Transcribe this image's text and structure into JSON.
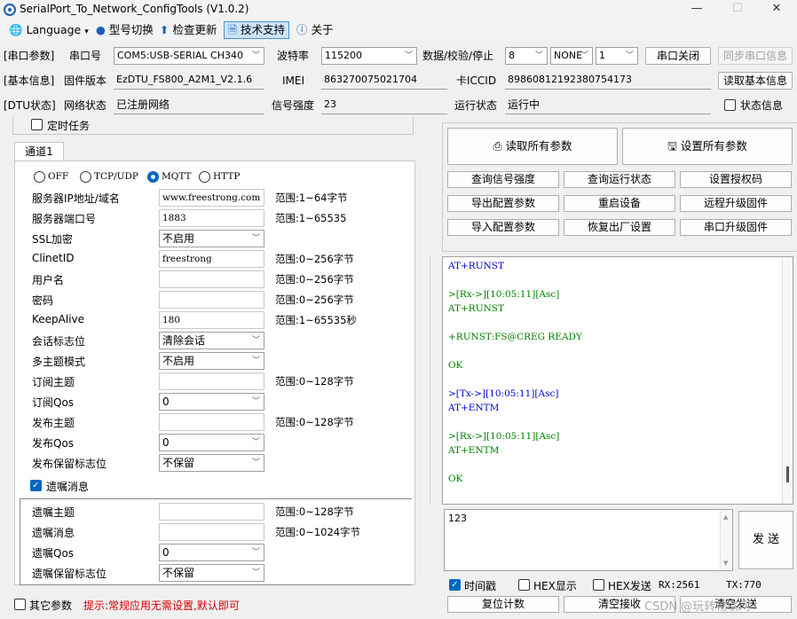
{
  "window": {
    "title": "SerialPort_To_Network_ConfigTools (V1.0.2)",
    "minimize": "—",
    "maximize": "☐",
    "close": "✕"
  },
  "menu": {
    "language": "Language",
    "model_switch": "型号切换",
    "check_update": "检查更新",
    "tech_support": "技术支持",
    "about": "关于"
  },
  "serial": {
    "section": "[串口参数]",
    "port_label": "串口号",
    "port_value": "COM5:USB-SERIAL CH340",
    "baud_label": "波特率",
    "baud_value": "115200",
    "dps_label": "数据/校验/停止",
    "data_bits": "8",
    "parity": "NONE",
    "stop_bits": "1",
    "close_button": "串口关闭",
    "sync_button": "同步串口信息"
  },
  "basic": {
    "section": "[基本信息]",
    "fw_label": "固件版本",
    "fw_value": "EzDTU_FS800_A2M1_V2.1.6",
    "imei_label": "IMEI",
    "imei_value": "863270075021704",
    "iccid_label": "卡ICCID",
    "iccid_value": "89860812192380754173",
    "read_button": "读取基本信息"
  },
  "status": {
    "section": "[DTU状态]",
    "net_label": "网络状态",
    "net_value": "已注册网络",
    "signal_label": "信号强度",
    "signal_value": "23",
    "run_label": "运行状态",
    "run_value": "运行中",
    "status_info": "状态信息"
  },
  "timer_task": "定时任务",
  "channel": {
    "tab": "通道1",
    "protocols": [
      "OFF",
      "TCP/UDP",
      "MQTT",
      "HTTP"
    ],
    "selected_protocol": "MQTT",
    "fields": [
      {
        "label": "服务器IP地址/域名",
        "value": "www.freestrong.com",
        "range": "范围:1~64字节",
        "type": "text"
      },
      {
        "label": "服务器端口号",
        "value": "1883",
        "range": "范围:1~65535",
        "type": "text"
      },
      {
        "label": "SSL加密",
        "value": "不启用",
        "range": "",
        "type": "select"
      },
      {
        "label": "ClinetID",
        "value": "freestrong",
        "range": "范围:0~256字节",
        "type": "text"
      },
      {
        "label": "用户名",
        "value": "",
        "range": "范围:0~256字节",
        "type": "text"
      },
      {
        "label": "密码",
        "value": "",
        "range": "范围:0~256字节",
        "type": "text"
      },
      {
        "label": "KeepAlive",
        "value": "180",
        "range": "范围:1~65535秒",
        "type": "text"
      },
      {
        "label": "会话标志位",
        "value": "清除会话",
        "range": "",
        "type": "select"
      },
      {
        "label": "多主题模式",
        "value": "不启用",
        "range": "",
        "type": "select"
      },
      {
        "label": "订阅主题",
        "value": "",
        "range": "范围:0~128字节",
        "type": "text"
      },
      {
        "label": "订阅Qos",
        "value": "0",
        "range": "",
        "type": "select"
      },
      {
        "label": "发布主题",
        "value": "",
        "range": "范围:0~128字节",
        "type": "text"
      },
      {
        "label": "发布Qos",
        "value": "0",
        "range": "",
        "type": "select"
      },
      {
        "label": "发布保留标志位",
        "value": "不保留",
        "range": "",
        "type": "select"
      }
    ],
    "will_checkbox": "遗嘱消息",
    "will_fields": [
      {
        "label": "遗嘱主题",
        "value": "",
        "range": "范围:0~128字节",
        "type": "text"
      },
      {
        "label": "遗嘱消息",
        "value": "",
        "range": "范围:0~1024字节",
        "type": "text"
      },
      {
        "label": "遗嘱Qos",
        "value": "0",
        "range": "",
        "type": "select"
      },
      {
        "label": "遗嘱保留标志位",
        "value": "不保留",
        "range": "",
        "type": "select"
      }
    ]
  },
  "other_params": "其它参数",
  "hint": "提示:常规应用无需设置,默认即可",
  "actions": {
    "read_all": "读取所有参数",
    "set_all": "设置所有参数",
    "grid": [
      [
        "查询信号强度",
        "查询运行状态",
        "设置授权码"
      ],
      [
        "导出配置参数",
        "重启设备",
        "远程升级固件"
      ],
      [
        "导入配置参数",
        "恢复出厂设置",
        "串口升级固件"
      ]
    ]
  },
  "log": [
    {
      "text": "AT+RUNST",
      "color": "#0000cc"
    },
    {
      "text": "",
      "color": "#000"
    },
    {
      "text": ">[Rx->][10:05:11][Asc]",
      "color": "#008000"
    },
    {
      "text": "AT+RUNST",
      "color": "#008000"
    },
    {
      "text": "",
      "color": "#000"
    },
    {
      "text": "+RUNST:FS@CREG READY",
      "color": "#008000"
    },
    {
      "text": "",
      "color": "#000"
    },
    {
      "text": "OK",
      "color": "#008000"
    },
    {
      "text": "",
      "color": "#000"
    },
    {
      "text": ">[Tx->][10:05:11][Asc]",
      "color": "#0000cc"
    },
    {
      "text": "AT+ENTM",
      "color": "#0000cc"
    },
    {
      "text": "",
      "color": "#000"
    },
    {
      "text": ">[Rx->][10:05:11][Asc]",
      "color": "#008000"
    },
    {
      "text": "AT+ENTM",
      "color": "#008000"
    },
    {
      "text": "",
      "color": "#000"
    },
    {
      "text": "OK",
      "color": "#008000"
    }
  ],
  "send": {
    "text": "123",
    "button": "发 送"
  },
  "bottom": {
    "timestamp": "时间戳",
    "hex_display": "HEX显示",
    "hex_send": "HEX发送",
    "rx": "RX:2561",
    "tx": "TX:770",
    "reset_count": "复位计数",
    "clear_recv": "清空接收",
    "clear_send": "清空发送"
  },
  "watermark": "CSDN @玩转物联网"
}
